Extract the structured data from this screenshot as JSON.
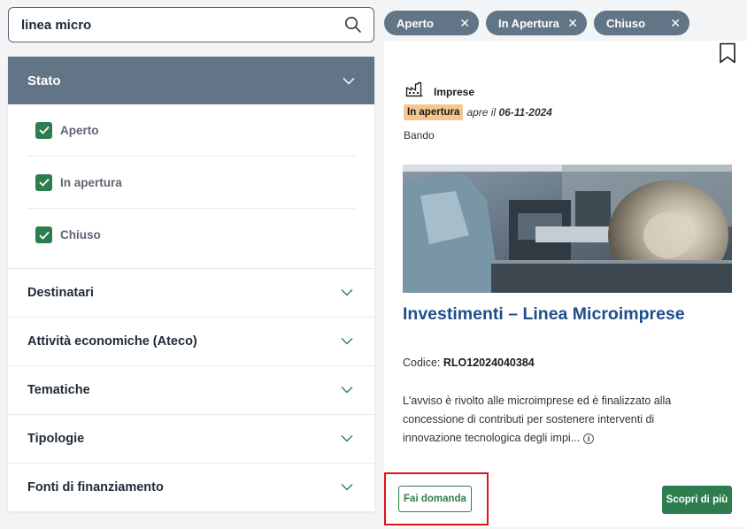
{
  "search": {
    "value": "linea micro",
    "placeholder": ""
  },
  "filters": {
    "stato": {
      "label": "Stato",
      "options": [
        {
          "label": "Aperto",
          "checked": true
        },
        {
          "label": "In apertura",
          "checked": true
        },
        {
          "label": "Chiuso",
          "checked": true
        }
      ]
    },
    "sections": [
      {
        "label": "Destinatari"
      },
      {
        "label": "Attività economiche (Ateco)"
      },
      {
        "label": "Tematiche"
      },
      {
        "label": "Tipologie"
      },
      {
        "label": "Fonti di finanziamento"
      }
    ]
  },
  "chips": [
    {
      "label": "Aperto"
    },
    {
      "label": "In Apertura"
    },
    {
      "label": "Chiuso"
    }
  ],
  "card": {
    "category": "Imprese",
    "status_badge": "In apertura",
    "opens_prefix": "apre il",
    "opens_date": "06-11-2024",
    "type": "Bando",
    "title": "Investimenti – Linea Microimprese",
    "code_label": "Codice:",
    "code_value": "RLO12024040384",
    "description": "L'avviso è rivolto alle microimprese ed è finalizzato alla concessione di contributi per sostenere interventi di innovazione tecnologica degli impi...",
    "apply_label": "Fai domanda",
    "more_label": "Scopri di più"
  },
  "colors": {
    "slate": "#627586",
    "green": "#2e7d4f",
    "title_blue": "#1f4f8b",
    "badge_orange": "#f3c78e",
    "highlight_red": "#e0131a"
  }
}
